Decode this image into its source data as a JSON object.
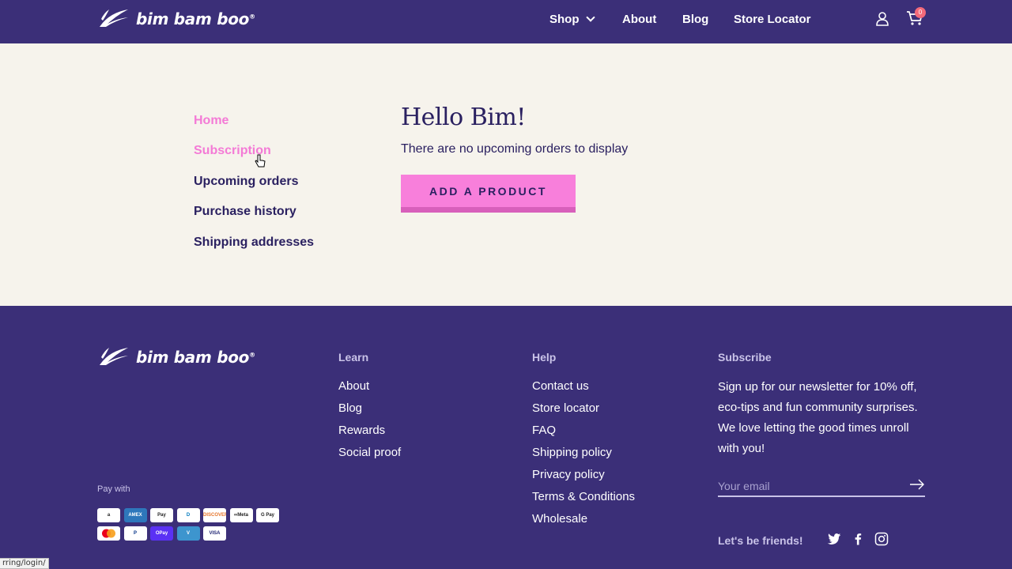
{
  "brand": {
    "name": "bim bam boo",
    "tm": "®"
  },
  "header": {
    "nav": [
      {
        "label": "Shop",
        "has_dropdown": true
      },
      {
        "label": "About"
      },
      {
        "label": "Blog"
      },
      {
        "label": "Store Locator"
      }
    ],
    "icons": [
      "user-icon",
      "cart-icon"
    ],
    "cart_count": "0"
  },
  "sidebar": {
    "items": [
      {
        "label": "Home",
        "active": true
      },
      {
        "label": "Subscription",
        "active": true,
        "hovered": true
      },
      {
        "label": "Upcoming orders"
      },
      {
        "label": "Purchase history"
      },
      {
        "label": "Shipping addresses"
      }
    ]
  },
  "main": {
    "greeting": "Hello Bim!",
    "empty_message": "There are no upcoming orders to display",
    "add_button": "ADD A PRODUCT"
  },
  "footer": {
    "learn": {
      "title": "Learn",
      "links": [
        "About",
        "Blog",
        "Rewards",
        "Social proof"
      ]
    },
    "help": {
      "title": "Help",
      "links": [
        "Contact us",
        "Store locator",
        "FAQ",
        "Shipping policy",
        "Privacy policy",
        "Terms & Conditions",
        "Wholesale"
      ]
    },
    "subscribe": {
      "title": "Subscribe",
      "text": "Sign up for our newsletter for 10% off, eco-tips and fun community surprises. We love letting the good times unroll with you!",
      "email_placeholder": "Your email"
    },
    "friends_label": "Let's be friends!",
    "social": [
      "twitter-icon",
      "facebook-icon",
      "instagram-icon"
    ],
    "pay_with_label": "Pay with",
    "payment_methods": [
      {
        "name": "amazon-pay-icon",
        "label": "a"
      },
      {
        "name": "amex-icon",
        "label": "AMEX"
      },
      {
        "name": "apple-pay-icon",
        "label": " Pay"
      },
      {
        "name": "diners-club-icon",
        "label": "D"
      },
      {
        "name": "discover-icon",
        "label": "DISCOVER"
      },
      {
        "name": "meta-pay-icon",
        "label": "∞Meta"
      },
      {
        "name": "google-pay-icon",
        "label": "G Pay"
      },
      {
        "name": "mastercard-icon",
        "label": ""
      },
      {
        "name": "paypal-icon",
        "label": "P"
      },
      {
        "name": "shop-pay-icon",
        "label": "OPay"
      },
      {
        "name": "venmo-icon",
        "label": "V"
      },
      {
        "name": "visa-icon",
        "label": "VISA"
      }
    ]
  },
  "status_bar_url": "rring/login/",
  "colors": {
    "brand_purple": "#3b2f78",
    "accent_pink": "#f87fdb",
    "text_dark": "#2a2060",
    "background": "#f6f3ec"
  }
}
